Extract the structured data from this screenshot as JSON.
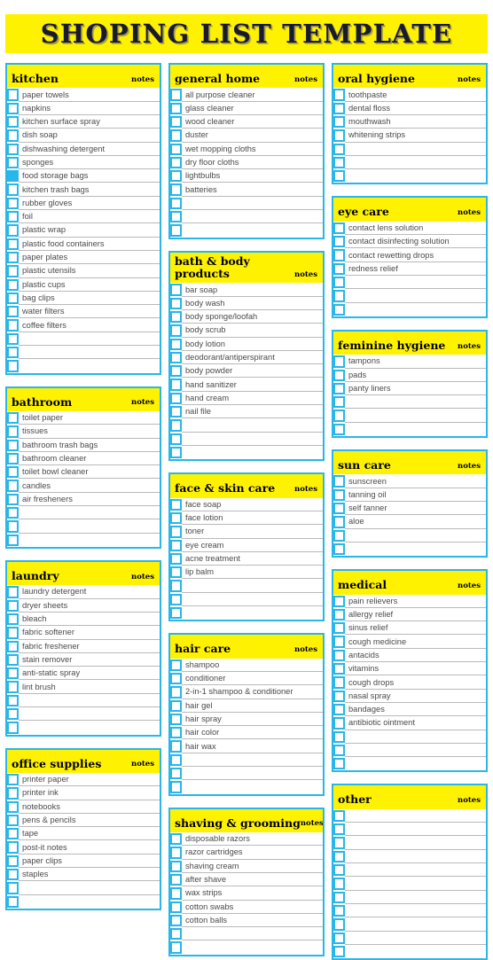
{
  "document": {
    "title": "SHOPING LIST TEMPLATE"
  },
  "labels": {
    "notes": "notes"
  },
  "colors": {
    "accent_yellow": "#fff200",
    "accent_cyan": "#29b6e8",
    "row_divider": "#b9b9b9",
    "text_dark": "#000000",
    "text_item": "#4a4a4a",
    "page_background": "#ffffff"
  },
  "columns": [
    {
      "name": "left-column",
      "cards": [
        {
          "id": "kitchen",
          "title": "kitchen",
          "notes": "notes",
          "items": [
            {
              "label": "paper towels",
              "checked": false
            },
            {
              "label": "napkins",
              "checked": false
            },
            {
              "label": "kitchen surface spray",
              "checked": false
            },
            {
              "label": "dish soap",
              "checked": false
            },
            {
              "label": "dishwashing detergent",
              "checked": false
            },
            {
              "label": "sponges",
              "checked": false
            },
            {
              "label": "food storage bags",
              "checked": true
            },
            {
              "label": "kitchen trash bags",
              "checked": false
            },
            {
              "label": "rubber gloves",
              "checked": false
            },
            {
              "label": "foil",
              "checked": false
            },
            {
              "label": "plastic wrap",
              "checked": false
            },
            {
              "label": "plastic food containers",
              "checked": false
            },
            {
              "label": "paper plates",
              "checked": false
            },
            {
              "label": "plastic utensils",
              "checked": false
            },
            {
              "label": "plastic cups",
              "checked": false
            },
            {
              "label": "bag clips",
              "checked": false
            },
            {
              "label": "water filters",
              "checked": false
            },
            {
              "label": "coffee filters",
              "checked": false
            },
            {
              "label": "",
              "checked": false
            },
            {
              "label": "",
              "checked": false
            },
            {
              "label": "",
              "checked": false
            }
          ]
        },
        {
          "id": "bathroom",
          "title": "bathroom",
          "notes": "notes",
          "items": [
            {
              "label": "toilet paper",
              "checked": false
            },
            {
              "label": "tissues",
              "checked": false
            },
            {
              "label": "bathroom trash bags",
              "checked": false
            },
            {
              "label": "bathroom cleaner",
              "checked": false
            },
            {
              "label": "toilet bowl cleaner",
              "checked": false
            },
            {
              "label": "candles",
              "checked": false
            },
            {
              "label": "air fresheners",
              "checked": false
            },
            {
              "label": "",
              "checked": false
            },
            {
              "label": "",
              "checked": false
            },
            {
              "label": "",
              "checked": false
            }
          ]
        },
        {
          "id": "laundry",
          "title": "laundry",
          "notes": "notes",
          "items": [
            {
              "label": "laundry detergent",
              "checked": false
            },
            {
              "label": "dryer sheets",
              "checked": false
            },
            {
              "label": "bleach",
              "checked": false
            },
            {
              "label": "fabric softener",
              "checked": false
            },
            {
              "label": "fabric freshener",
              "checked": false
            },
            {
              "label": "stain remover",
              "checked": false
            },
            {
              "label": "anti-static spray",
              "checked": false
            },
            {
              "label": "lint brush",
              "checked": false
            },
            {
              "label": "",
              "checked": false
            },
            {
              "label": "",
              "checked": false
            },
            {
              "label": "",
              "checked": false
            }
          ]
        },
        {
          "id": "office-supplies",
          "title": "office supplies",
          "notes": "notes",
          "items": [
            {
              "label": "printer paper",
              "checked": false
            },
            {
              "label": "printer ink",
              "checked": false
            },
            {
              "label": "notebooks",
              "checked": false
            },
            {
              "label": "pens & pencils",
              "checked": false
            },
            {
              "label": "tape",
              "checked": false
            },
            {
              "label": "post-it notes",
              "checked": false
            },
            {
              "label": "paper clips",
              "checked": false
            },
            {
              "label": "staples",
              "checked": false
            },
            {
              "label": "",
              "checked": false
            },
            {
              "label": "",
              "checked": false
            }
          ]
        }
      ]
    },
    {
      "name": "middle-column",
      "cards": [
        {
          "id": "general-home",
          "title": "general home",
          "notes": "notes",
          "items": [
            {
              "label": "all purpose cleaner",
              "checked": false
            },
            {
              "label": "glass cleaner",
              "checked": false
            },
            {
              "label": "wood cleaner",
              "checked": false
            },
            {
              "label": "duster",
              "checked": false
            },
            {
              "label": "wet mopping cloths",
              "checked": false
            },
            {
              "label": "dry floor cloths",
              "checked": false
            },
            {
              "label": "lightbulbs",
              "checked": false
            },
            {
              "label": "batteries",
              "checked": false
            },
            {
              "label": "",
              "checked": false
            },
            {
              "label": "",
              "checked": false
            },
            {
              "label": "",
              "checked": false
            }
          ]
        },
        {
          "id": "bath-body-products",
          "title": "bath & body",
          "title_line2": "products",
          "notes": "notes",
          "items": [
            {
              "label": "bar soap",
              "checked": false
            },
            {
              "label": "body wash",
              "checked": false
            },
            {
              "label": "body sponge/loofah",
              "checked": false
            },
            {
              "label": "body scrub",
              "checked": false
            },
            {
              "label": "body lotion",
              "checked": false
            },
            {
              "label": "deodorant/antiperspirant",
              "checked": false
            },
            {
              "label": "body powder",
              "checked": false
            },
            {
              "label": "hand sanitizer",
              "checked": false
            },
            {
              "label": "hand cream",
              "checked": false
            },
            {
              "label": "nail file",
              "checked": false
            },
            {
              "label": "",
              "checked": false
            },
            {
              "label": "",
              "checked": false
            },
            {
              "label": "",
              "checked": false
            }
          ]
        },
        {
          "id": "face-skin-care",
          "title": "face & skin care",
          "notes": "notes",
          "items": [
            {
              "label": "face soap",
              "checked": false
            },
            {
              "label": "face lotion",
              "checked": false
            },
            {
              "label": "toner",
              "checked": false
            },
            {
              "label": "eye cream",
              "checked": false
            },
            {
              "label": "acne treatment",
              "checked": false
            },
            {
              "label": "lip balm",
              "checked": false
            },
            {
              "label": "",
              "checked": false
            },
            {
              "label": "",
              "checked": false
            },
            {
              "label": "",
              "checked": false
            }
          ]
        },
        {
          "id": "hair-care",
          "title": "hair care",
          "notes": "notes",
          "items": [
            {
              "label": "shampoo",
              "checked": false
            },
            {
              "label": "conditioner",
              "checked": false
            },
            {
              "label": "2-in-1 shampoo & conditioner",
              "checked": false
            },
            {
              "label": "hair gel",
              "checked": false
            },
            {
              "label": "hair spray",
              "checked": false
            },
            {
              "label": "hair color",
              "checked": false
            },
            {
              "label": "hair wax",
              "checked": false
            },
            {
              "label": "",
              "checked": false
            },
            {
              "label": "",
              "checked": false
            },
            {
              "label": "",
              "checked": false
            }
          ]
        },
        {
          "id": "shaving-grooming",
          "title": "shaving & grooming",
          "notes": "notes",
          "items": [
            {
              "label": "disposable razors",
              "checked": false
            },
            {
              "label": "razor cartridges",
              "checked": false
            },
            {
              "label": "shaving cream",
              "checked": false
            },
            {
              "label": "after shave",
              "checked": false
            },
            {
              "label": "wax strips",
              "checked": false
            },
            {
              "label": "cotton swabs",
              "checked": false
            },
            {
              "label": "cotton balls",
              "checked": false
            },
            {
              "label": "",
              "checked": false
            },
            {
              "label": "",
              "checked": false
            }
          ]
        }
      ]
    },
    {
      "name": "right-column",
      "cards": [
        {
          "id": "oral-hygiene",
          "title": "oral hygiene",
          "notes": "notes",
          "items": [
            {
              "label": "toothpaste",
              "checked": false
            },
            {
              "label": "dental floss",
              "checked": false
            },
            {
              "label": "mouthwash",
              "checked": false
            },
            {
              "label": "whitening strips",
              "checked": false
            },
            {
              "label": "",
              "checked": false
            },
            {
              "label": "",
              "checked": false
            },
            {
              "label": "",
              "checked": false
            }
          ]
        },
        {
          "id": "eye-care",
          "title": "eye care",
          "notes": "notes",
          "items": [
            {
              "label": "contact lens solution",
              "checked": false
            },
            {
              "label": "contact disinfecting solution",
              "checked": false
            },
            {
              "label": "contact rewetting drops",
              "checked": false
            },
            {
              "label": "redness relief",
              "checked": false
            },
            {
              "label": "",
              "checked": false
            },
            {
              "label": "",
              "checked": false
            },
            {
              "label": "",
              "checked": false
            }
          ]
        },
        {
          "id": "feminine-hygiene",
          "title": "feminine hygiene",
          "notes": "notes",
          "items": [
            {
              "label": "tampons",
              "checked": false
            },
            {
              "label": "pads",
              "checked": false
            },
            {
              "label": "panty liners",
              "checked": false
            },
            {
              "label": "",
              "checked": false
            },
            {
              "label": "",
              "checked": false
            },
            {
              "label": "",
              "checked": false
            }
          ]
        },
        {
          "id": "sun-care",
          "title": "sun care",
          "notes": "notes",
          "items": [
            {
              "label": "sunscreen",
              "checked": false
            },
            {
              "label": "tanning oil",
              "checked": false
            },
            {
              "label": "self tanner",
              "checked": false
            },
            {
              "label": "aloe",
              "checked": false
            },
            {
              "label": "",
              "checked": false
            },
            {
              "label": "",
              "checked": false
            }
          ]
        },
        {
          "id": "medical",
          "title": "medical",
          "notes": "notes",
          "items": [
            {
              "label": "pain relievers",
              "checked": false
            },
            {
              "label": "allergy relief",
              "checked": false
            },
            {
              "label": "sinus relief",
              "checked": false
            },
            {
              "label": "cough medicine",
              "checked": false
            },
            {
              "label": "antacids",
              "checked": false
            },
            {
              "label": "vitamins",
              "checked": false
            },
            {
              "label": "cough drops",
              "checked": false
            },
            {
              "label": "nasal spray",
              "checked": false
            },
            {
              "label": "bandages",
              "checked": false
            },
            {
              "label": "antibiotic ointment",
              "checked": false
            },
            {
              "label": "",
              "checked": false
            },
            {
              "label": "",
              "checked": false
            },
            {
              "label": "",
              "checked": false
            }
          ]
        },
        {
          "id": "other",
          "title": "other",
          "notes": "notes",
          "items": [
            {
              "label": "",
              "checked": false
            },
            {
              "label": "",
              "checked": false
            },
            {
              "label": "",
              "checked": false
            },
            {
              "label": "",
              "checked": false
            },
            {
              "label": "",
              "checked": false
            },
            {
              "label": "",
              "checked": false
            },
            {
              "label": "",
              "checked": false
            },
            {
              "label": "",
              "checked": false
            },
            {
              "label": "",
              "checked": false
            },
            {
              "label": "",
              "checked": false
            },
            {
              "label": "",
              "checked": false
            }
          ]
        }
      ]
    }
  ]
}
